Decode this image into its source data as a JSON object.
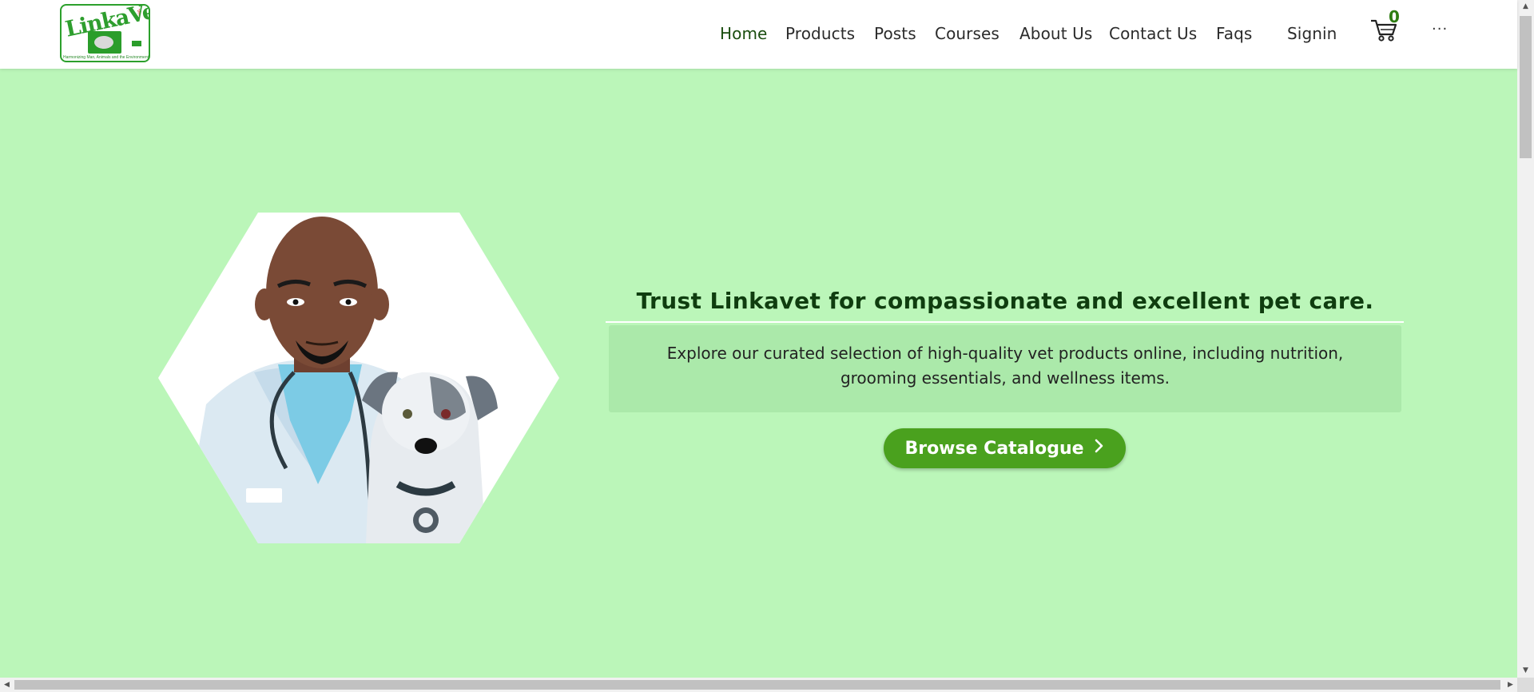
{
  "logo": {
    "word": "LinkaVet",
    "tagline": "Harmonizing Man, Animals and the Environment",
    "icon": "linkavet-logo-icon"
  },
  "nav": {
    "items": [
      {
        "label": "Home",
        "active": true
      },
      {
        "label": "Products"
      },
      {
        "label": "Posts"
      },
      {
        "label": "Courses"
      },
      {
        "label": "About Us"
      },
      {
        "label": "Contact Us"
      },
      {
        "label": "Faqs"
      },
      {
        "label": "Signin"
      }
    ],
    "cart_count": "0",
    "cart_icon": "cart-icon",
    "more_label": "···"
  },
  "hero": {
    "headline": "Trust Linkavet for compassionate and excellent pet care.",
    "description": "Explore our curated selection of high-quality vet products online, including nutrition, grooming essentials, and wellness items.",
    "cta_label": "Browse Catalogue",
    "cta_icon": "chevron-right-icon",
    "image": "vet-with-dog-illustration"
  },
  "colors": {
    "hero_bg": "#bbf6b9",
    "accent": "#4aa11e",
    "headline": "#0f3d0f"
  }
}
